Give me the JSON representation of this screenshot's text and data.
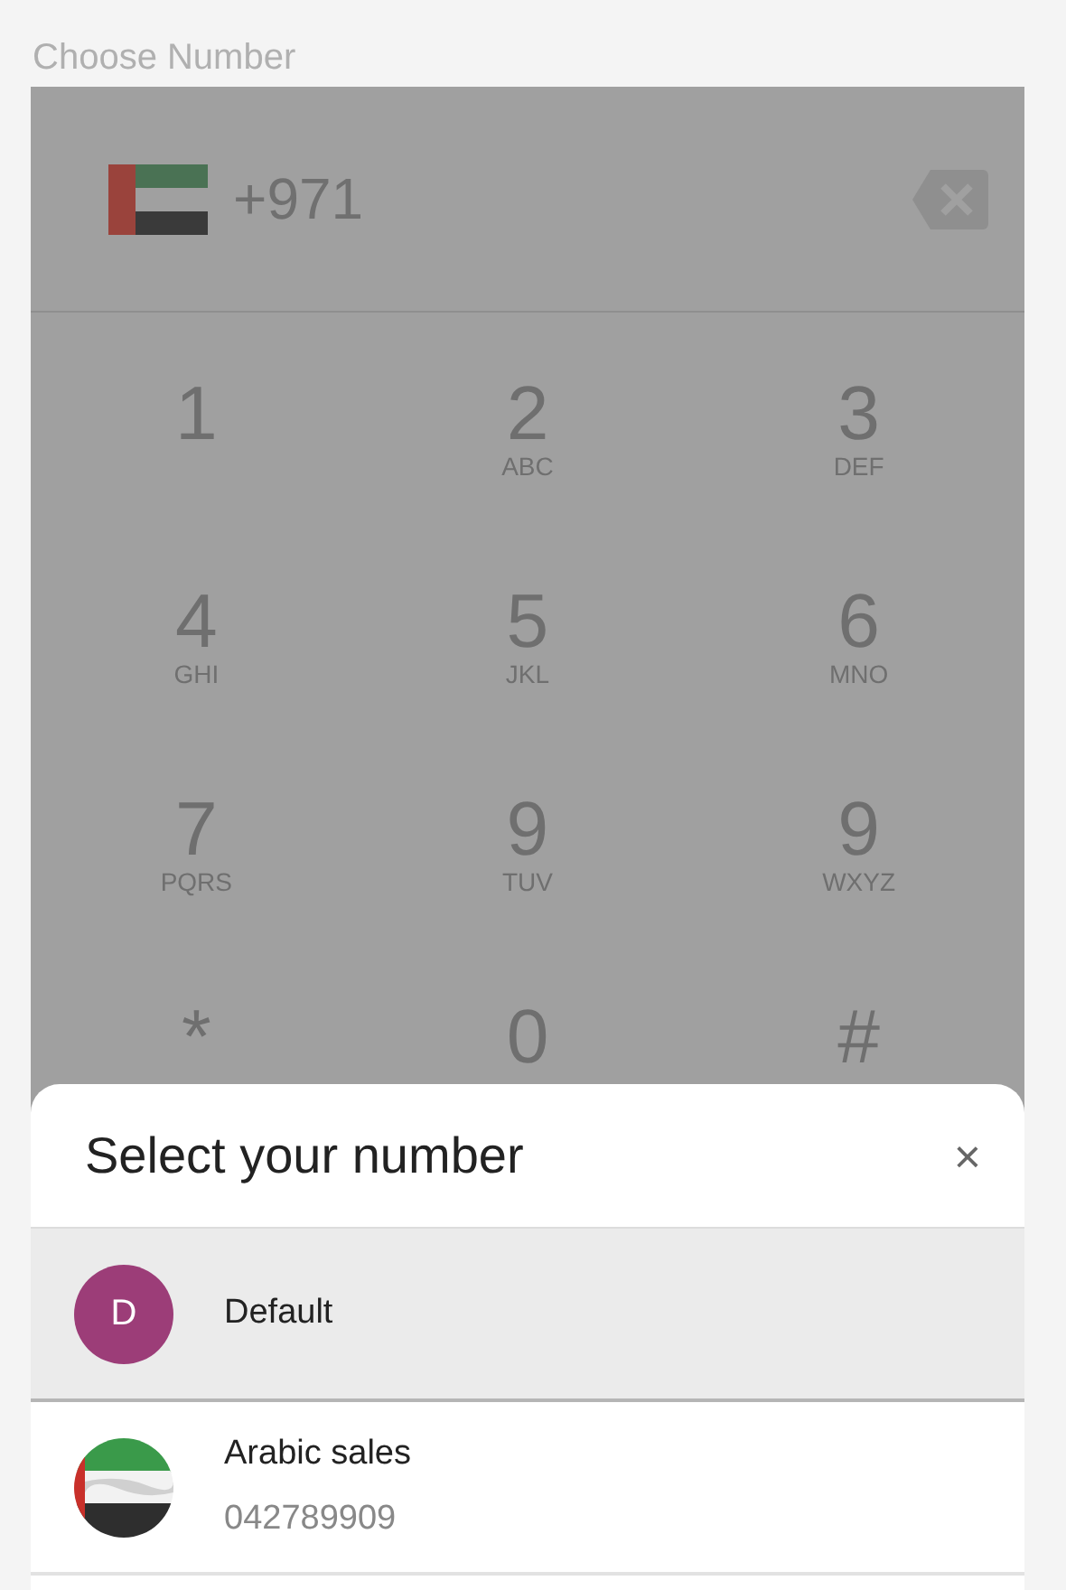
{
  "label": "Choose Number",
  "dialer": {
    "country_code": "+971",
    "keys": [
      {
        "digit": "1"
      },
      {
        "digit": "2",
        "letters": "ABC"
      },
      {
        "digit": "3",
        "letters": "DEF"
      },
      {
        "digit": "4",
        "letters": "GHI"
      },
      {
        "digit": "5",
        "letters": "JKL"
      },
      {
        "digit": "6",
        "letters": "MNO"
      },
      {
        "digit": "7",
        "letters": "PQRS"
      },
      {
        "digit": "9",
        "letters": "TUV"
      },
      {
        "digit": "9",
        "letters": "WXYZ"
      },
      {
        "digit": "*"
      },
      {
        "digit": "0"
      },
      {
        "digit": "#"
      }
    ]
  },
  "sheet": {
    "title": "Select your number",
    "close": "×",
    "numbers": [
      {
        "kind": "letter",
        "initial": "D",
        "color": "#9c3d78",
        "name": "Default",
        "selected": true
      },
      {
        "kind": "flag",
        "name": "Arabic sales",
        "number": "042789909",
        "selected": false
      }
    ]
  }
}
